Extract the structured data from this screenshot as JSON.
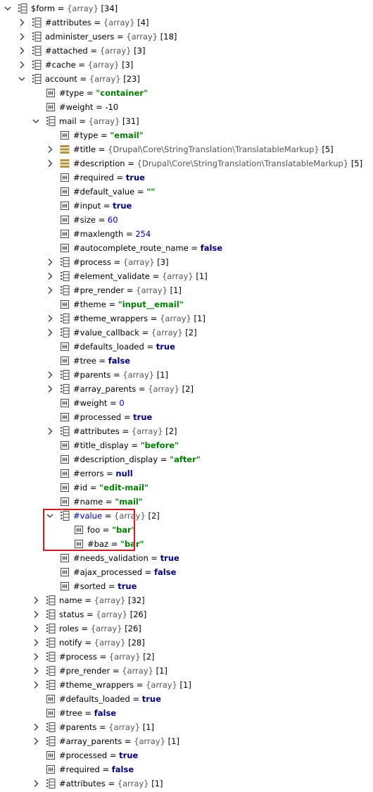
{
  "rows": [
    {
      "name": "$form",
      "type": "{array}",
      "extra": "[34]",
      "kind": "array",
      "toggle": "expanded"
    },
    {
      "name": "#attributes",
      "type": "{array}",
      "extra": "[4]",
      "kind": "array",
      "toggle": "collapsed"
    },
    {
      "name": "administer_users",
      "type": "{array}",
      "extra": "[18]",
      "kind": "array",
      "toggle": "collapsed"
    },
    {
      "name": "#attached",
      "type": "{array}",
      "extra": "[3]",
      "kind": "array",
      "toggle": "collapsed"
    },
    {
      "name": "#cache",
      "type": "{array}",
      "extra": "[3]",
      "kind": "array",
      "toggle": "collapsed"
    },
    {
      "name": "account",
      "type": "{array}",
      "extra": "[23]",
      "kind": "array",
      "toggle": "expanded"
    },
    {
      "name": "#type",
      "value": "\"container\"",
      "kind": "scalar",
      "vclass": "string"
    },
    {
      "name": "#weight",
      "value": "-10",
      "kind": "scalar",
      "vclass": "plain"
    },
    {
      "name": "mail",
      "type": "{array}",
      "extra": "[31]",
      "kind": "array",
      "toggle": "expanded"
    },
    {
      "name": "#type",
      "value": "\"email\"",
      "kind": "scalar",
      "vclass": "string"
    },
    {
      "name": "#title",
      "type": "{Drupal\\Core\\StringTranslation\\TranslatableMarkup}",
      "extra": "[5]",
      "kind": "object",
      "toggle": "collapsed"
    },
    {
      "name": "#description",
      "type": "{Drupal\\Core\\StringTranslation\\TranslatableMarkup}",
      "extra": "[5]",
      "kind": "object",
      "toggle": "collapsed"
    },
    {
      "name": "#required",
      "value": "true",
      "kind": "scalar",
      "vclass": "keyword"
    },
    {
      "name": "#default_value",
      "value": "\"\"",
      "kind": "scalar",
      "vclass": "string"
    },
    {
      "name": "#input",
      "value": "true",
      "kind": "scalar",
      "vclass": "keyword"
    },
    {
      "name": "#size",
      "value": "60",
      "kind": "scalar",
      "vclass": "number"
    },
    {
      "name": "#maxlength",
      "value": "254",
      "kind": "scalar",
      "vclass": "number"
    },
    {
      "name": "#autocomplete_route_name",
      "value": "false",
      "kind": "scalar",
      "vclass": "keyword"
    },
    {
      "name": "#process",
      "type": "{array}",
      "extra": "[3]",
      "kind": "array",
      "toggle": "collapsed"
    },
    {
      "name": "#element_validate",
      "type": "{array}",
      "extra": "[1]",
      "kind": "array",
      "toggle": "collapsed"
    },
    {
      "name": "#pre_render",
      "type": "{array}",
      "extra": "[1]",
      "kind": "array",
      "toggle": "collapsed"
    },
    {
      "name": "#theme",
      "value": "\"input__email\"",
      "kind": "scalar",
      "vclass": "string"
    },
    {
      "name": "#theme_wrappers",
      "type": "{array}",
      "extra": "[1]",
      "kind": "array",
      "toggle": "collapsed"
    },
    {
      "name": "#value_callback",
      "type": "{array}",
      "extra": "[2]",
      "kind": "array",
      "toggle": "collapsed"
    },
    {
      "name": "#defaults_loaded",
      "value": "true",
      "kind": "scalar",
      "vclass": "keyword"
    },
    {
      "name": "#tree",
      "value": "false",
      "kind": "scalar",
      "vclass": "keyword"
    },
    {
      "name": "#parents",
      "type": "{array}",
      "extra": "[1]",
      "kind": "array",
      "toggle": "collapsed"
    },
    {
      "name": "#array_parents",
      "type": "{array}",
      "extra": "[2]",
      "kind": "array",
      "toggle": "collapsed"
    },
    {
      "name": "#weight",
      "value": "0",
      "kind": "scalar",
      "vclass": "number"
    },
    {
      "name": "#processed",
      "value": "true",
      "kind": "scalar",
      "vclass": "keyword"
    },
    {
      "name": "#attributes",
      "type": "{array}",
      "extra": "[2]",
      "kind": "array",
      "toggle": "collapsed"
    },
    {
      "name": "#title_display",
      "value": "\"before\"",
      "kind": "scalar",
      "vclass": "string"
    },
    {
      "name": "#description_display",
      "value": "\"after\"",
      "kind": "scalar",
      "vclass": "string"
    },
    {
      "name": "#errors",
      "value": "null",
      "kind": "scalar",
      "vclass": "keyword"
    },
    {
      "name": "#id",
      "value": "\"edit-mail\"",
      "kind": "scalar",
      "vclass": "string"
    },
    {
      "name": "#name",
      "value": "\"mail\"",
      "kind": "scalar",
      "vclass": "string"
    },
    {
      "name": "#value",
      "type": "{array}",
      "extra": "[2]",
      "kind": "array",
      "toggle": "expanded",
      "namecolor": "blue"
    },
    {
      "name": "foo",
      "value": "\"bar\"",
      "kind": "scalar",
      "vclass": "string"
    },
    {
      "name": "#baz",
      "value": "\"bar\"",
      "kind": "scalar",
      "vclass": "string"
    },
    {
      "name": "#needs_validation",
      "value": "true",
      "kind": "scalar",
      "vclass": "keyword"
    },
    {
      "name": "#ajax_processed",
      "value": "false",
      "kind": "scalar",
      "vclass": "keyword"
    },
    {
      "name": "#sorted",
      "value": "true",
      "kind": "scalar",
      "vclass": "keyword"
    },
    {
      "name": "name",
      "type": "{array}",
      "extra": "[32]",
      "kind": "array",
      "toggle": "collapsed"
    },
    {
      "name": "status",
      "type": "{array}",
      "extra": "[26]",
      "kind": "array",
      "toggle": "collapsed"
    },
    {
      "name": "roles",
      "type": "{array}",
      "extra": "[26]",
      "kind": "array",
      "toggle": "collapsed"
    },
    {
      "name": "notify",
      "type": "{array}",
      "extra": "[28]",
      "kind": "array",
      "toggle": "collapsed"
    },
    {
      "name": "#process",
      "type": "{array}",
      "extra": "[2]",
      "kind": "array",
      "toggle": "collapsed"
    },
    {
      "name": "#pre_render",
      "type": "{array}",
      "extra": "[1]",
      "kind": "array",
      "toggle": "collapsed"
    },
    {
      "name": "#theme_wrappers",
      "type": "{array}",
      "extra": "[1]",
      "kind": "array",
      "toggle": "collapsed"
    },
    {
      "name": "#defaults_loaded",
      "value": "true",
      "kind": "scalar",
      "vclass": "keyword"
    },
    {
      "name": "#tree",
      "value": "false",
      "kind": "scalar",
      "vclass": "keyword"
    },
    {
      "name": "#parents",
      "type": "{array}",
      "extra": "[1]",
      "kind": "array",
      "toggle": "collapsed"
    },
    {
      "name": "#array_parents",
      "type": "{array}",
      "extra": "[1]",
      "kind": "array",
      "toggle": "collapsed"
    },
    {
      "name": "#processed",
      "value": "true",
      "kind": "scalar",
      "vclass": "keyword"
    },
    {
      "name": "#required",
      "value": "false",
      "kind": "scalar",
      "vclass": "keyword"
    },
    {
      "name": "#attributes",
      "type": "{array}",
      "extra": "[1]",
      "kind": "array",
      "toggle": "collapsed"
    }
  ],
  "colors": {
    "string": "#008000",
    "keyword": "#00007f",
    "number": "#0000c0",
    "highlight": "#e0151c",
    "icon": "#4a4a4a",
    "object_icon": "#b8913a"
  },
  "icons": {
    "array": "array-icon",
    "scalar": "scalar-icon",
    "object": "object-icon",
    "expanded": "chevron-down-icon",
    "collapsed": "chevron-right-icon"
  }
}
